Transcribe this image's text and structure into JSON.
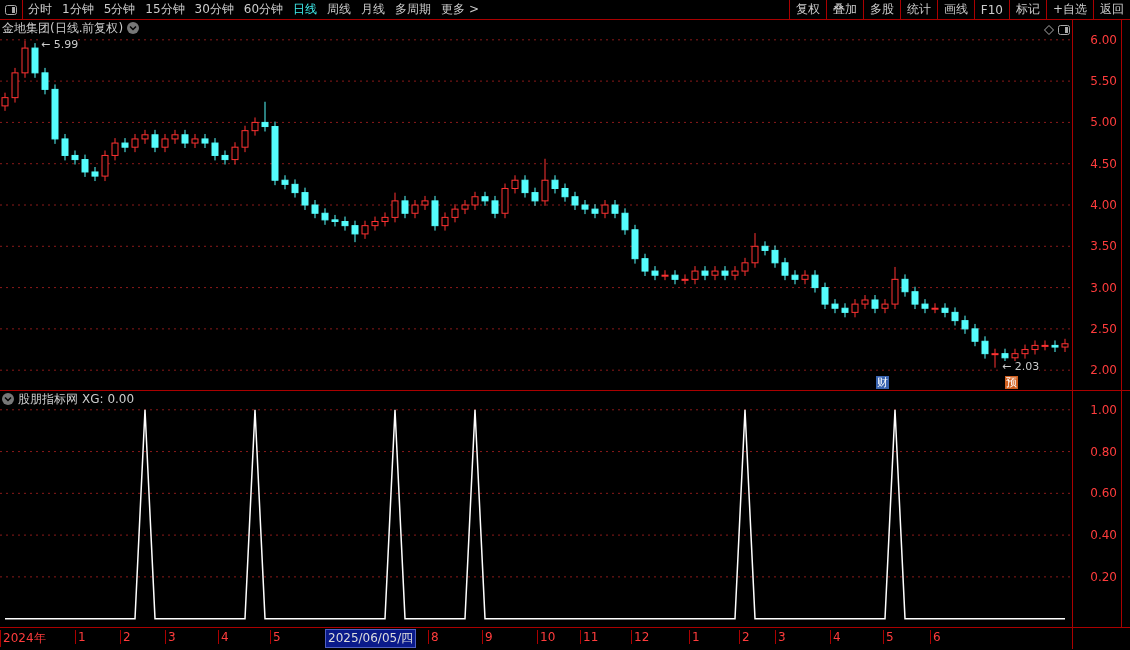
{
  "toolbar": {
    "tabs": [
      {
        "label": "分时",
        "selected": false
      },
      {
        "label": "1分钟",
        "selected": false
      },
      {
        "label": "5分钟",
        "selected": false
      },
      {
        "label": "15分钟",
        "selected": false
      },
      {
        "label": "30分钟",
        "selected": false
      },
      {
        "label": "60分钟",
        "selected": false
      },
      {
        "label": "日线",
        "selected": true
      },
      {
        "label": "周线",
        "selected": false
      },
      {
        "label": "月线",
        "selected": false
      },
      {
        "label": "多周期",
        "selected": false
      },
      {
        "label": "更多 >",
        "selected": false
      }
    ],
    "buttons": [
      "复权",
      "叠加",
      "多股",
      "统计",
      "画线",
      "F10",
      "标记",
      "+自选",
      "返回"
    ]
  },
  "price_panel": {
    "title": "金地集团(日线.前复权)",
    "chart_data": {
      "type": "candlestick",
      "ylim": [
        1.76,
        6.24
      ],
      "yticks": [
        {
          "value": 2,
          "label": "2.00"
        },
        {
          "value": 2.5,
          "label": "2.50"
        },
        {
          "value": 3,
          "label": "3.00"
        },
        {
          "value": 3.5,
          "label": "3.50"
        },
        {
          "value": 4,
          "label": "4.00"
        },
        {
          "value": 4.5,
          "label": "4.50"
        },
        {
          "value": 5,
          "label": "5.00"
        },
        {
          "value": 5.5,
          "label": "5.50"
        },
        {
          "value": 6,
          "label": "6.00"
        }
      ],
      "ohlc": [
        [
          5.2,
          5.36,
          5.14,
          5.3
        ],
        [
          5.3,
          5.66,
          5.24,
          5.6
        ],
        [
          5.6,
          5.99,
          5.54,
          5.9
        ],
        [
          5.9,
          5.96,
          5.54,
          5.6
        ],
        [
          5.6,
          5.66,
          5.34,
          5.4
        ],
        [
          5.4,
          5.46,
          4.74,
          4.8
        ],
        [
          4.8,
          4.86,
          4.54,
          4.6
        ],
        [
          4.6,
          4.66,
          4.49,
          4.55
        ],
        [
          4.55,
          4.61,
          4.34,
          4.4
        ],
        [
          4.4,
          4.46,
          4.29,
          4.35
        ],
        [
          4.35,
          4.66,
          4.29,
          4.6
        ],
        [
          4.6,
          4.81,
          4.54,
          4.75
        ],
        [
          4.75,
          4.81,
          4.64,
          4.7
        ],
        [
          4.7,
          4.86,
          4.64,
          4.8
        ],
        [
          4.8,
          4.91,
          4.74,
          4.85
        ],
        [
          4.85,
          4.91,
          4.64,
          4.7
        ],
        [
          4.7,
          4.86,
          4.64,
          4.8
        ],
        [
          4.8,
          4.91,
          4.74,
          4.85
        ],
        [
          4.85,
          4.91,
          4.69,
          4.75
        ],
        [
          4.75,
          4.86,
          4.69,
          4.8
        ],
        [
          4.8,
          4.86,
          4.69,
          4.75
        ],
        [
          4.75,
          4.81,
          4.54,
          4.6
        ],
        [
          4.6,
          4.66,
          4.49,
          4.55
        ],
        [
          4.55,
          4.76,
          4.49,
          4.7
        ],
        [
          4.7,
          4.96,
          4.64,
          4.9
        ],
        [
          4.9,
          5.06,
          4.84,
          5.0
        ],
        [
          5.0,
          5.25,
          4.89,
          4.95
        ],
        [
          4.95,
          5.01,
          4.24,
          4.3
        ],
        [
          4.3,
          4.36,
          4.19,
          4.25
        ],
        [
          4.25,
          4.31,
          4.09,
          4.15
        ],
        [
          4.15,
          4.21,
          3.94,
          4.0
        ],
        [
          4.0,
          4.06,
          3.84,
          3.9
        ],
        [
          3.9,
          3.96,
          3.76,
          3.82
        ],
        [
          3.82,
          3.88,
          3.74,
          3.8
        ],
        [
          3.8,
          3.86,
          3.69,
          3.75
        ],
        [
          3.75,
          3.81,
          3.55,
          3.65
        ],
        [
          3.65,
          3.81,
          3.59,
          3.75
        ],
        [
          3.75,
          3.86,
          3.69,
          3.8
        ],
        [
          3.8,
          3.91,
          3.74,
          3.85
        ],
        [
          3.85,
          4.15,
          3.79,
          4.05
        ],
        [
          4.05,
          4.11,
          3.84,
          3.9
        ],
        [
          3.9,
          4.06,
          3.84,
          4.0
        ],
        [
          4.0,
          4.11,
          3.94,
          4.05
        ],
        [
          4.05,
          4.11,
          3.69,
          3.75
        ],
        [
          3.75,
          3.91,
          3.69,
          3.85
        ],
        [
          3.85,
          4.01,
          3.79,
          3.95
        ],
        [
          3.95,
          4.06,
          3.89,
          4.0
        ],
        [
          4.0,
          4.16,
          3.94,
          4.1
        ],
        [
          4.1,
          4.16,
          3.99,
          4.05
        ],
        [
          4.05,
          4.11,
          3.84,
          3.9
        ],
        [
          3.9,
          4.26,
          3.84,
          4.2
        ],
        [
          4.2,
          4.36,
          4.14,
          4.3
        ],
        [
          4.3,
          4.36,
          4.09,
          4.15
        ],
        [
          4.15,
          4.21,
          3.99,
          4.05
        ],
        [
          4.05,
          4.56,
          3.99,
          4.3
        ],
        [
          4.3,
          4.36,
          4.14,
          4.2
        ],
        [
          4.2,
          4.26,
          4.04,
          4.1
        ],
        [
          4.1,
          4.16,
          3.94,
          4.0
        ],
        [
          4.0,
          4.06,
          3.89,
          3.95
        ],
        [
          3.95,
          4.01,
          3.84,
          3.9
        ],
        [
          3.9,
          4.06,
          3.84,
          4.0
        ],
        [
          4.0,
          4.06,
          3.84,
          3.9
        ],
        [
          3.9,
          3.96,
          3.64,
          3.7
        ],
        [
          3.7,
          3.76,
          3.29,
          3.35
        ],
        [
          3.35,
          3.41,
          3.14,
          3.2
        ],
        [
          3.2,
          3.26,
          3.09,
          3.15
        ],
        [
          3.15,
          3.21,
          3.09,
          3.15
        ],
        [
          3.15,
          3.21,
          3.04,
          3.1
        ],
        [
          3.1,
          3.16,
          3.04,
          3.1
        ],
        [
          3.1,
          3.26,
          3.04,
          3.2
        ],
        [
          3.2,
          3.26,
          3.09,
          3.15
        ],
        [
          3.15,
          3.26,
          3.09,
          3.2
        ],
        [
          3.2,
          3.26,
          3.09,
          3.15
        ],
        [
          3.15,
          3.26,
          3.09,
          3.2
        ],
        [
          3.2,
          3.36,
          3.14,
          3.3
        ],
        [
          3.3,
          3.66,
          3.24,
          3.5
        ],
        [
          3.5,
          3.56,
          3.39,
          3.45
        ],
        [
          3.45,
          3.51,
          3.24,
          3.3
        ],
        [
          3.3,
          3.36,
          3.09,
          3.15
        ],
        [
          3.15,
          3.21,
          3.04,
          3.1
        ],
        [
          3.1,
          3.21,
          3.04,
          3.15
        ],
        [
          3.15,
          3.21,
          2.94,
          3.0
        ],
        [
          3.0,
          3.06,
          2.74,
          2.8
        ],
        [
          2.8,
          2.86,
          2.69,
          2.75
        ],
        [
          2.75,
          2.81,
          2.64,
          2.7
        ],
        [
          2.7,
          2.86,
          2.64,
          2.8
        ],
        [
          2.8,
          2.91,
          2.74,
          2.85
        ],
        [
          2.85,
          2.91,
          2.69,
          2.75
        ],
        [
          2.75,
          2.86,
          2.69,
          2.8
        ],
        [
          2.8,
          3.25,
          2.74,
          3.1
        ],
        [
          3.1,
          3.16,
          2.89,
          2.95
        ],
        [
          2.95,
          3.01,
          2.74,
          2.8
        ],
        [
          2.8,
          2.86,
          2.69,
          2.75
        ],
        [
          2.75,
          2.81,
          2.69,
          2.75
        ],
        [
          2.75,
          2.81,
          2.64,
          2.7
        ],
        [
          2.7,
          2.76,
          2.54,
          2.6
        ],
        [
          2.6,
          2.66,
          2.44,
          2.5
        ],
        [
          2.5,
          2.56,
          2.29,
          2.35
        ],
        [
          2.35,
          2.41,
          2.14,
          2.2
        ],
        [
          2.2,
          2.26,
          2.03,
          2.2
        ],
        [
          2.2,
          2.26,
          2.09,
          2.15
        ],
        [
          2.15,
          2.26,
          2.09,
          2.2
        ],
        [
          2.2,
          2.31,
          2.14,
          2.25
        ],
        [
          2.25,
          2.36,
          2.19,
          2.3
        ],
        [
          2.3,
          2.36,
          2.24,
          2.3
        ],
        [
          2.3,
          2.36,
          2.22,
          2.28
        ],
        [
          2.28,
          2.38,
          2.22,
          2.32
        ]
      ],
      "grid": true
    },
    "price_marks": [
      "← 5.99",
      "← 2.03"
    ],
    "event_badges": [
      {
        "label": "财",
        "color": "#3a64b0"
      },
      {
        "label": "预",
        "color": "#d06020"
      }
    ]
  },
  "indicator_panel": {
    "title": "股朋指标网",
    "reading": "XG: 0.00",
    "chart_data": {
      "type": "line",
      "ylim": [
        -0.04,
        1.09
      ],
      "yticks": [
        {
          "value": 0.2,
          "label": "0.20"
        },
        {
          "value": 0.4,
          "label": "0.40"
        },
        {
          "value": 0.6,
          "label": "0.60"
        },
        {
          "value": 0.8,
          "label": "0.80"
        },
        {
          "value": 1,
          "label": "1.00"
        }
      ],
      "series": [
        {
          "color": "#ffffff",
          "values": [
            0,
            0,
            0,
            0,
            0,
            0,
            0,
            0,
            0,
            0,
            0,
            0,
            0,
            0,
            1,
            0,
            0,
            0,
            0,
            0,
            0,
            0,
            0,
            0,
            0,
            1,
            0,
            0,
            0,
            0,
            0,
            0,
            0,
            0,
            0,
            0,
            0,
            0,
            0,
            1,
            0,
            0,
            0,
            0,
            0,
            0,
            0,
            1,
            0,
            0,
            0,
            0,
            0,
            0,
            0,
            0,
            0,
            0,
            0,
            0,
            0,
            0,
            0,
            0,
            0,
            0,
            0,
            0,
            0,
            0,
            0,
            0,
            0,
            0,
            1,
            0,
            0,
            0,
            0,
            0,
            0,
            0,
            0,
            0,
            0,
            0,
            0,
            0,
            0,
            1,
            0,
            0,
            0,
            0,
            0,
            0,
            0,
            0,
            0,
            0,
            0,
            0,
            0,
            0,
            0,
            0,
            0
          ]
        }
      ],
      "grid": true
    }
  },
  "date_axis": {
    "labels": [
      "2024年",
      "1",
      "2",
      "3",
      "4",
      "5",
      "8",
      "9",
      "10",
      "11",
      "12",
      "1",
      "2",
      "3",
      "4",
      "5",
      "6"
    ],
    "cursor_date": "2025/06/05/四"
  }
}
